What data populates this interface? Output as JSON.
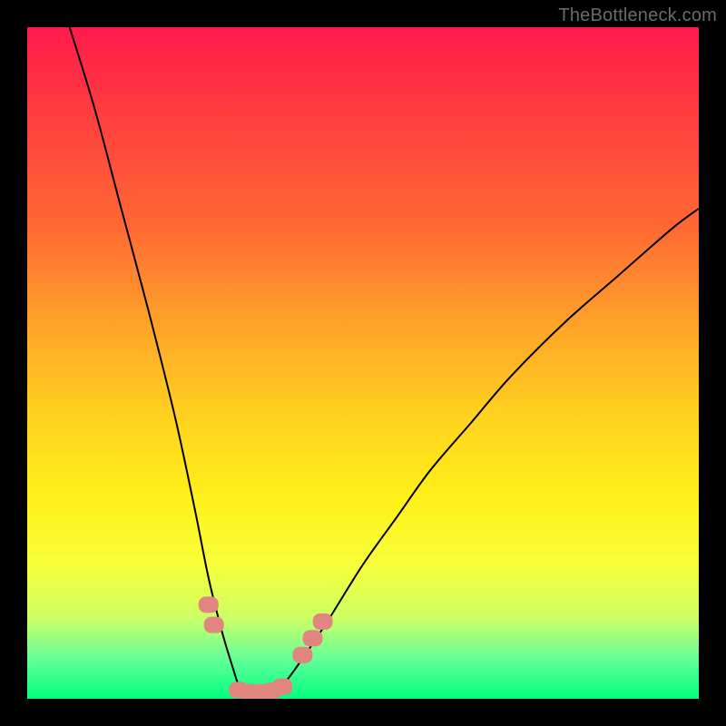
{
  "watermark": "TheBottleneck.com",
  "colors": {
    "frame": "#000000",
    "gradient_top": "#ff1a4d",
    "gradient_bottom": "#00ff7f",
    "curve": "#000000",
    "markers": "#e0857f"
  },
  "chart_data": {
    "type": "line",
    "title": "",
    "xlabel": "",
    "ylabel": "",
    "xlim": [
      0,
      100
    ],
    "ylim": [
      0,
      100
    ],
    "grid": false,
    "legend": false,
    "series": [
      {
        "name": "bottleneck-curve",
        "x": [
          6,
          10,
          14,
          18,
          22,
          25,
          27,
          29,
          30.5,
          31.5,
          32.5,
          34,
          36,
          38,
          41,
          45,
          50,
          55,
          60,
          66,
          72,
          80,
          88,
          96,
          100
        ],
        "y": [
          101,
          88,
          73,
          58,
          42,
          28,
          18,
          10,
          5,
          2,
          1,
          1,
          1,
          2,
          6,
          12,
          20,
          27,
          34,
          41,
          48,
          56,
          63,
          70,
          73
        ]
      }
    ],
    "markers": [
      {
        "x": 27.0,
        "y": 14.0
      },
      {
        "x": 27.8,
        "y": 11.0
      },
      {
        "x": 31.5,
        "y": 1.3
      },
      {
        "x": 33.0,
        "y": 1.0
      },
      {
        "x": 34.8,
        "y": 1.0
      },
      {
        "x": 36.5,
        "y": 1.2
      },
      {
        "x": 38.0,
        "y": 1.8
      },
      {
        "x": 41.0,
        "y": 6.5
      },
      {
        "x": 42.5,
        "y": 9.0
      },
      {
        "x": 44.0,
        "y": 11.5
      }
    ]
  }
}
